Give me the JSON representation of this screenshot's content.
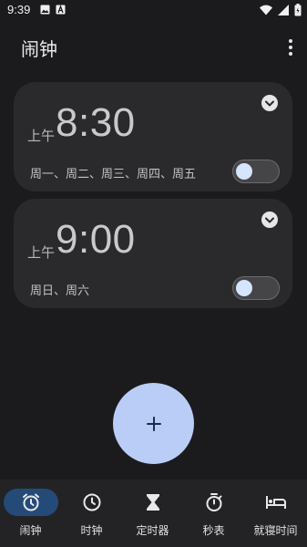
{
  "status_bar": {
    "time": "9:39",
    "icons_left": [
      "image-icon",
      "text-a-icon"
    ],
    "icons_right": [
      "wifi-icon",
      "signal-icon",
      "battery-icon"
    ]
  },
  "app_bar": {
    "title": "闹钟",
    "menu_icon": "more-vert-icon"
  },
  "alarms": [
    {
      "ampm": "上午",
      "time": "8:30",
      "days": "周一、周二、周三、周四、周五",
      "enabled": false
    },
    {
      "ampm": "上午",
      "time": "9:00",
      "days": "周日、周六",
      "enabled": false
    }
  ],
  "fab": {
    "icon": "plus-icon"
  },
  "bottom_nav": {
    "items": [
      {
        "label": "闹钟",
        "icon": "alarm-icon",
        "active": true
      },
      {
        "label": "时钟",
        "icon": "clock-icon",
        "active": false
      },
      {
        "label": "定时器",
        "icon": "hourglass-icon",
        "active": false
      },
      {
        "label": "秒表",
        "icon": "stopwatch-icon",
        "active": false
      },
      {
        "label": "就寝时间",
        "icon": "bed-icon",
        "active": false
      }
    ]
  },
  "colors": {
    "background": "#1b1b1d",
    "card": "#2a2a2d",
    "fab": "#b9cdf7",
    "nav_active": "#244b78",
    "toggle_knob": "#d5e4ff"
  }
}
